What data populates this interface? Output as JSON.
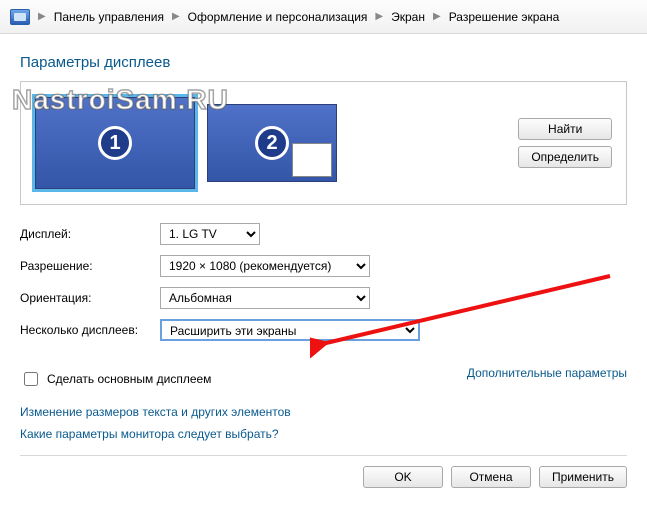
{
  "breadcrumb": {
    "items": [
      "Панель управления",
      "Оформление и персонализация",
      "Экран",
      "Разрешение экрана"
    ]
  },
  "heading": "Параметры дисплеев",
  "watermark": "NastroiSam.RU",
  "monitors": {
    "m1_label": "1",
    "m2_label": "2"
  },
  "side_buttons": {
    "find": "Найти",
    "detect": "Определить"
  },
  "form": {
    "display_label": "Дисплей:",
    "display_value": "1. LG TV",
    "resolution_label": "Разрешение:",
    "resolution_value": "1920 × 1080 (рекомендуется)",
    "orientation_label": "Ориентация:",
    "orientation_value": "Альбомная",
    "multi_label": "Несколько дисплеев:",
    "multi_value": "Расширить эти экраны"
  },
  "checkbox": {
    "label": "Сделать основным дисплеем",
    "checked": false
  },
  "links": {
    "advanced": "Дополнительные параметры",
    "text_size": "Изменение размеров текста и других элементов",
    "which_settings": "Какие параметры монитора следует выбрать?"
  },
  "footer": {
    "ok": "OK",
    "cancel": "Отмена",
    "apply": "Применить"
  }
}
